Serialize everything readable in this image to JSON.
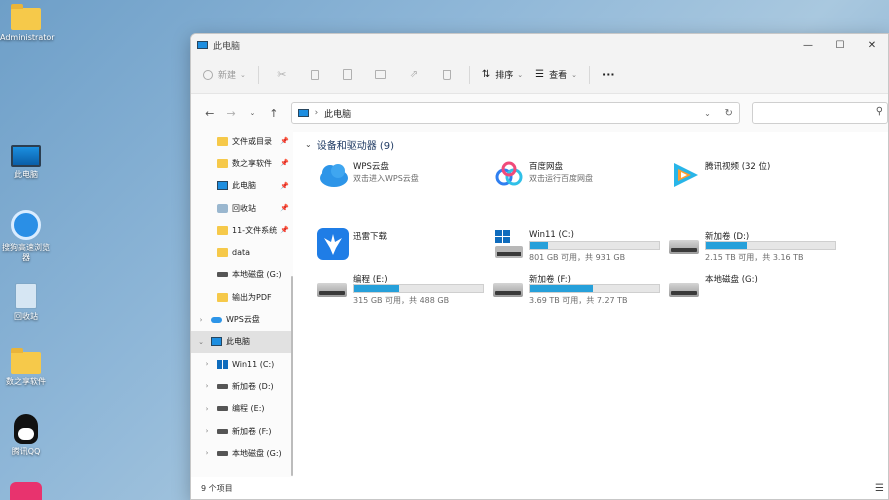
{
  "desktop": {
    "icons": [
      {
        "label": "Administrator",
        "icon": "folder-icon"
      },
      {
        "label": "此电脑",
        "icon": "monitor-icon"
      },
      {
        "label": "搜狗高速浏览器",
        "icon": "sogou-browser-icon"
      },
      {
        "label": "回收站",
        "icon": "recycle-bin-icon"
      },
      {
        "label": "数之享软件",
        "icon": "folder-icon"
      },
      {
        "label": "腾讯QQ",
        "icon": "qq-icon"
      }
    ]
  },
  "window": {
    "title": "此电脑",
    "controls": {
      "minimize": "—",
      "maximize": "☐",
      "close": "✕"
    }
  },
  "toolbar": {
    "new_label": "新建",
    "sort_label": "排序",
    "view_label": "查看",
    "more_label": "···"
  },
  "address": {
    "location": "此电脑",
    "search_placeholder": ""
  },
  "sidebar": {
    "quick_access": [
      {
        "label": "文件或目录",
        "icon": "folder-icon",
        "pinned": true
      },
      {
        "label": "数之享软件",
        "icon": "folder-icon",
        "pinned": true
      },
      {
        "label": "此电脑",
        "icon": "monitor-icon",
        "pinned": true
      },
      {
        "label": "回收站",
        "icon": "recycle-bin-icon",
        "pinned": true
      },
      {
        "label": "11-文件系统",
        "icon": "folder-icon",
        "pinned": true
      },
      {
        "label": "data",
        "icon": "folder-icon",
        "pinned": false
      },
      {
        "label": "本地磁盘 (G:)",
        "icon": "drive-icon",
        "pinned": false
      },
      {
        "label": "输出为PDF",
        "icon": "folder-icon",
        "pinned": false
      }
    ],
    "wps_cloud": "WPS云盘",
    "this_pc": "此电脑",
    "drives": [
      {
        "label": "Win11 (C:)",
        "icon": "windows-drive-icon"
      },
      {
        "label": "新加卷 (D:)",
        "icon": "drive-icon"
      },
      {
        "label": "编程 (E:)",
        "icon": "drive-icon"
      },
      {
        "label": "新加卷 (F:)",
        "icon": "drive-icon"
      },
      {
        "label": "本地磁盘 (G:)",
        "icon": "drive-icon"
      }
    ]
  },
  "content": {
    "group_title": "设备和驱动器 (9)",
    "tiles": [
      {
        "name": "WPS云盘",
        "sub": "双击进入WPS云盘",
        "icon": "wps-cloud-icon"
      },
      {
        "name": "百度网盘",
        "sub": "双击运行百度网盘",
        "icon": "baidu-netdisk-icon"
      },
      {
        "name": "腾讯视频 (32 位)",
        "sub": "",
        "icon": "tencent-video-icon"
      },
      {
        "name": "迅雷下载",
        "sub": "",
        "icon": "xunlei-icon"
      },
      {
        "name": "Win11 (C:)",
        "capacity": "801 GB 可用，共 931 GB",
        "used_fraction": 0.14,
        "icon": "windows-drive-icon"
      },
      {
        "name": "新加卷 (D:)",
        "capacity": "2.15 TB 可用，共 3.16 TB",
        "used_fraction": 0.32,
        "icon": "drive-icon"
      },
      {
        "name": "编程 (E:)",
        "capacity": "315 GB 可用，共 488 GB",
        "used_fraction": 0.35,
        "icon": "drive-icon"
      },
      {
        "name": "新加卷 (F:)",
        "capacity": "3.69 TB 可用，共 7.27 TB",
        "used_fraction": 0.49,
        "icon": "drive-icon"
      },
      {
        "name": "本地磁盘 (G:)",
        "capacity": "",
        "icon": "drive-icon"
      }
    ]
  },
  "status": {
    "item_count": "9 个项目"
  },
  "colors": {
    "accent": "#26a0da",
    "folder": "#f6c94a"
  }
}
